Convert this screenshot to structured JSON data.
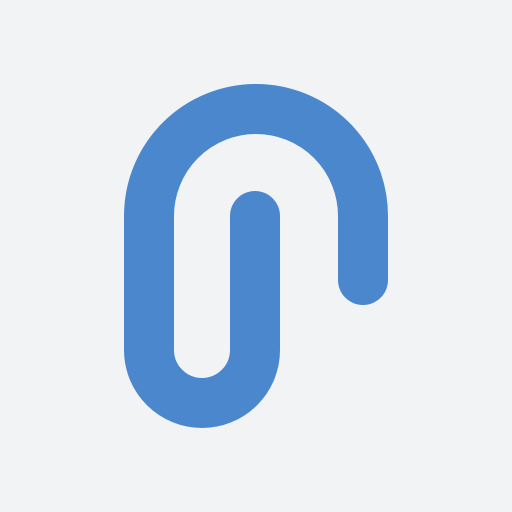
{
  "background_color": "#f1f3f5",
  "logo": {
    "icon": "paperclip-icon",
    "color": "#4a87cc"
  }
}
